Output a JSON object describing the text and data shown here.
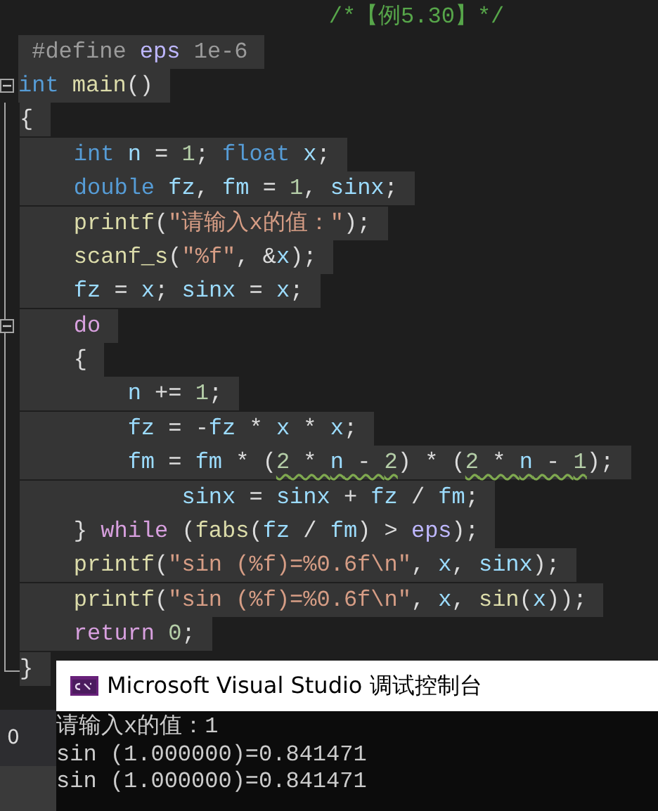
{
  "editor": {
    "lines": [
      {
        "selected": false,
        "tokens": [
          {
            "color": "#57a64a",
            "t": "                       /*【例5.30】*/"
          }
        ]
      },
      {
        "selected": true,
        "tokens": [
          {
            "color": "#9b9b9b",
            "t": " #define "
          },
          {
            "color": "#beb7ff",
            "t": "eps"
          },
          {
            "color": "#9b9b9b",
            "t": " 1e-6"
          }
        ]
      },
      {
        "selected": true,
        "fold": true,
        "tokens": [
          {
            "color": "#569cd6",
            "t": "int "
          },
          {
            "color": "#dcdcaa",
            "t": "main"
          },
          {
            "color": "#dcdcdc",
            "t": "()"
          }
        ]
      },
      {
        "selected": true,
        "tokens": [
          {
            "color": "#dcdcdc",
            "t": "{"
          }
        ]
      },
      {
        "selected": true,
        "tokens": [
          {
            "color": "#569cd6",
            "t": "    int "
          },
          {
            "color": "#9cdcfe",
            "t": "n"
          },
          {
            "color": "#dcdcdc",
            "t": " = "
          },
          {
            "color": "#b5cea8",
            "t": "1"
          },
          {
            "color": "#dcdcdc",
            "t": "; "
          },
          {
            "color": "#569cd6",
            "t": "float "
          },
          {
            "color": "#9cdcfe",
            "t": "x"
          },
          {
            "color": "#dcdcdc",
            "t": ";"
          }
        ]
      },
      {
        "selected": true,
        "tokens": [
          {
            "color": "#569cd6",
            "t": "    double "
          },
          {
            "color": "#9cdcfe",
            "t": "fz"
          },
          {
            "color": "#dcdcdc",
            "t": ", "
          },
          {
            "color": "#9cdcfe",
            "t": "fm"
          },
          {
            "color": "#dcdcdc",
            "t": " = "
          },
          {
            "color": "#b5cea8",
            "t": "1"
          },
          {
            "color": "#dcdcdc",
            "t": ", "
          },
          {
            "color": "#9cdcfe",
            "t": "sinx"
          },
          {
            "color": "#dcdcdc",
            "t": ";"
          }
        ]
      },
      {
        "selected": true,
        "tokens": [
          {
            "color": "#dcdcaa",
            "t": "    printf"
          },
          {
            "color": "#dcdcdc",
            "t": "("
          },
          {
            "color": "#d69d85",
            "t": "″请输入x的值：″"
          },
          {
            "color": "#dcdcdc",
            "t": ");"
          }
        ]
      },
      {
        "selected": true,
        "tokens": [
          {
            "color": "#dcdcaa",
            "t": "    scanf_s"
          },
          {
            "color": "#dcdcdc",
            "t": "("
          },
          {
            "color": "#d69d85",
            "t": "″%f″"
          },
          {
            "color": "#dcdcdc",
            "t": ", &"
          },
          {
            "color": "#9cdcfe",
            "t": "x"
          },
          {
            "color": "#dcdcdc",
            "t": ");"
          }
        ]
      },
      {
        "selected": true,
        "tokens": [
          {
            "color": "#9cdcfe",
            "t": "    fz"
          },
          {
            "color": "#dcdcdc",
            "t": " = "
          },
          {
            "color": "#9cdcfe",
            "t": "x"
          },
          {
            "color": "#dcdcdc",
            "t": "; "
          },
          {
            "color": "#9cdcfe",
            "t": "sinx"
          },
          {
            "color": "#dcdcdc",
            "t": " = "
          },
          {
            "color": "#9cdcfe",
            "t": "x"
          },
          {
            "color": "#dcdcdc",
            "t": ";"
          }
        ]
      },
      {
        "selected": true,
        "fold": true,
        "tokens": [
          {
            "color": "#d8a0df",
            "t": "    do"
          }
        ]
      },
      {
        "selected": true,
        "tokens": [
          {
            "color": "#dcdcdc",
            "t": "    {"
          }
        ]
      },
      {
        "selected": true,
        "tokens": [
          {
            "color": "#9cdcfe",
            "t": "        n"
          },
          {
            "color": "#dcdcdc",
            "t": " += "
          },
          {
            "color": "#b5cea8",
            "t": "1"
          },
          {
            "color": "#dcdcdc",
            "t": ";"
          }
        ]
      },
      {
        "selected": true,
        "tokens": [
          {
            "color": "#9cdcfe",
            "t": "        fz"
          },
          {
            "color": "#dcdcdc",
            "t": " = -"
          },
          {
            "color": "#9cdcfe",
            "t": "fz"
          },
          {
            "color": "#dcdcdc",
            "t": " * "
          },
          {
            "color": "#9cdcfe",
            "t": "x"
          },
          {
            "color": "#dcdcdc",
            "t": " * "
          },
          {
            "color": "#9cdcfe",
            "t": "x"
          },
          {
            "color": "#dcdcdc",
            "t": ";"
          }
        ]
      },
      {
        "selected": true,
        "tokens": [
          {
            "color": "#9cdcfe",
            "t": "        fm"
          },
          {
            "color": "#dcdcdc",
            "t": " = "
          },
          {
            "color": "#9cdcfe",
            "t": "fm"
          },
          {
            "color": "#dcdcdc",
            "t": " * ("
          },
          {
            "warn": true,
            "tokens": [
              {
                "color": "#b5cea8",
                "t": "2"
              },
              {
                "color": "#dcdcdc",
                "t": " * "
              },
              {
                "color": "#9cdcfe",
                "t": "n"
              },
              {
                "color": "#dcdcdc",
                "t": " - "
              },
              {
                "color": "#b5cea8",
                "t": "2"
              }
            ]
          },
          {
            "color": "#dcdcdc",
            "t": ") * ("
          },
          {
            "warn": true,
            "tokens": [
              {
                "color": "#b5cea8",
                "t": "2"
              },
              {
                "color": "#dcdcdc",
                "t": " * "
              },
              {
                "color": "#9cdcfe",
                "t": "n"
              },
              {
                "color": "#dcdcdc",
                "t": " - "
              },
              {
                "color": "#b5cea8",
                "t": "1"
              }
            ]
          },
          {
            "color": "#dcdcdc",
            "t": ");"
          }
        ]
      },
      {
        "selected": true,
        "tokens": [
          {
            "color": "#9cdcfe",
            "t": "            sinx"
          },
          {
            "color": "#dcdcdc",
            "t": " = "
          },
          {
            "color": "#9cdcfe",
            "t": "sinx"
          },
          {
            "color": "#dcdcdc",
            "t": " + "
          },
          {
            "color": "#9cdcfe",
            "t": "fz"
          },
          {
            "color": "#dcdcdc",
            "t": " / "
          },
          {
            "color": "#9cdcfe",
            "t": "fm"
          },
          {
            "color": "#dcdcdc",
            "t": ";"
          }
        ]
      },
      {
        "selected": true,
        "tokens": [
          {
            "color": "#dcdcdc",
            "t": "    } "
          },
          {
            "color": "#d8a0df",
            "t": "while"
          },
          {
            "color": "#dcdcdc",
            "t": " ("
          },
          {
            "color": "#dcdcaa",
            "t": "fabs"
          },
          {
            "color": "#dcdcdc",
            "t": "("
          },
          {
            "color": "#9cdcfe",
            "t": "fz"
          },
          {
            "color": "#dcdcdc",
            "t": " / "
          },
          {
            "color": "#9cdcfe",
            "t": "fm"
          },
          {
            "color": "#dcdcdc",
            "t": ") > "
          },
          {
            "color": "#beb7ff",
            "t": "eps"
          },
          {
            "color": "#dcdcdc",
            "t": ");"
          }
        ]
      },
      {
        "selected": true,
        "tokens": [
          {
            "color": "#dcdcaa",
            "t": "    printf"
          },
          {
            "color": "#dcdcdc",
            "t": "("
          },
          {
            "color": "#d69d85",
            "t": "″sin (%f)=%0.6f\\n″"
          },
          {
            "color": "#dcdcdc",
            "t": ", "
          },
          {
            "color": "#9cdcfe",
            "t": "x"
          },
          {
            "color": "#dcdcdc",
            "t": ", "
          },
          {
            "color": "#9cdcfe",
            "t": "sinx"
          },
          {
            "color": "#dcdcdc",
            "t": ");"
          }
        ]
      },
      {
        "selected": true,
        "tokens": [
          {
            "color": "#dcdcaa",
            "t": "    printf"
          },
          {
            "color": "#dcdcdc",
            "t": "("
          },
          {
            "color": "#d69d85",
            "t": "″sin (%f)=%0.6f\\n″"
          },
          {
            "color": "#dcdcdc",
            "t": ", "
          },
          {
            "color": "#9cdcfe",
            "t": "x"
          },
          {
            "color": "#dcdcdc",
            "t": ", "
          },
          {
            "color": "#dcdcaa",
            "t": "sin"
          },
          {
            "color": "#dcdcdc",
            "t": "("
          },
          {
            "color": "#9cdcfe",
            "t": "x"
          },
          {
            "color": "#dcdcdc",
            "t": "));"
          }
        ]
      },
      {
        "selected": true,
        "tokens": [
          {
            "color": "#d8a0df",
            "t": "    return "
          },
          {
            "color": "#b5cea8",
            "t": "0"
          },
          {
            "color": "#dcdcdc",
            "t": ";"
          }
        ]
      },
      {
        "selected": true,
        "tokens": [
          {
            "color": "#dcdcdc",
            "t": "}"
          }
        ]
      }
    ]
  },
  "side_panel": {
    "value": "0"
  },
  "console": {
    "title": "Microsoft Visual Studio 调试控制台",
    "lines": [
      "请输入x的值：1",
      "sin (1.000000)=0.841471",
      "sin (1.000000)=0.841471"
    ]
  }
}
